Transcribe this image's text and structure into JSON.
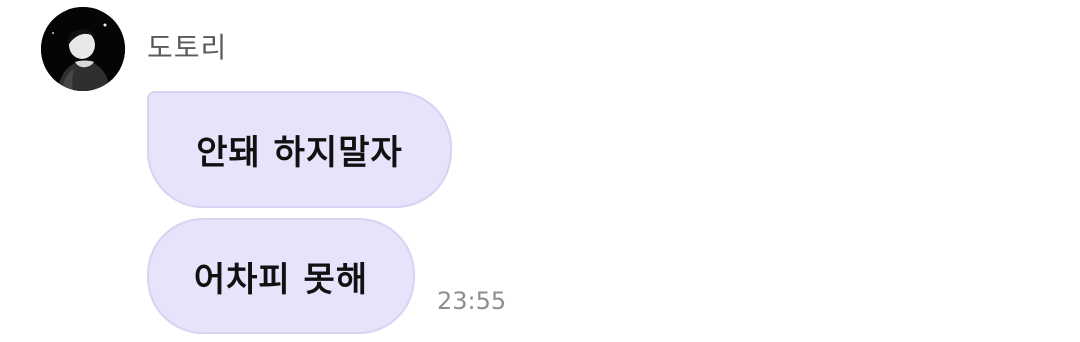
{
  "message_group": {
    "sender_name": "도토리",
    "avatar_icon": "profile-photo",
    "messages": [
      {
        "text": "안돼 하지말자"
      },
      {
        "text": "어차피 못해",
        "time": "23:55"
      }
    ]
  },
  "colors": {
    "bubble_fill": "#e6e3fb",
    "bubble_border": "#d8d3f3",
    "sender_text": "#5b5b5b",
    "message_text": "#111111",
    "timestamp_text": "#8e8e8e"
  }
}
